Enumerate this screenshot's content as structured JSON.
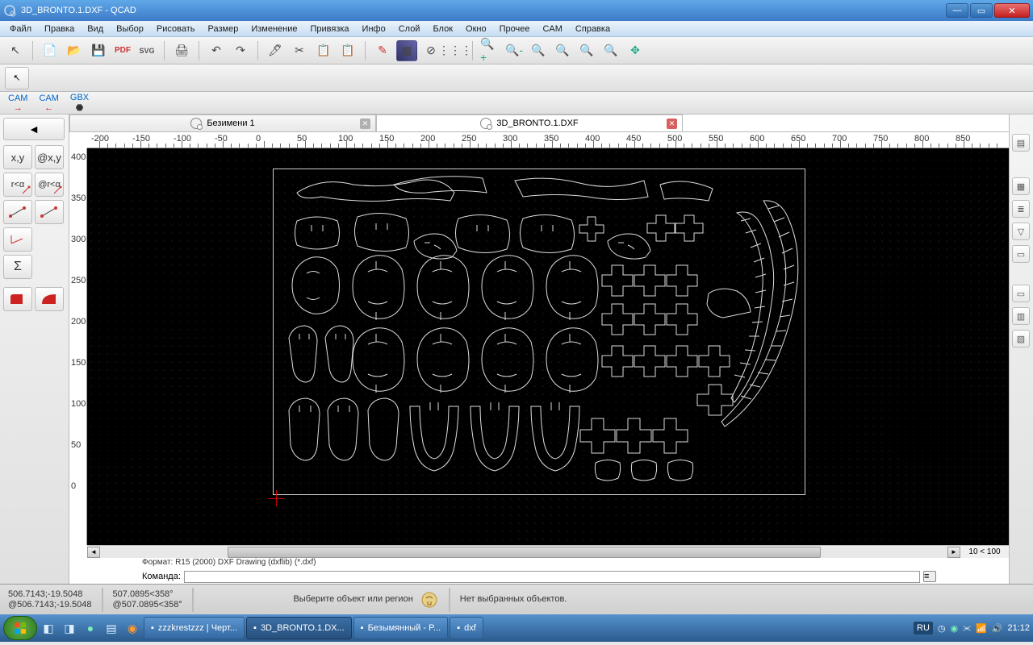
{
  "title": "3D_BRONTO.1.DXF - QCAD",
  "menu": [
    "Файл",
    "Правка",
    "Вид",
    "Выбор",
    "Рисовать",
    "Размер",
    "Изменение",
    "Привязка",
    "Инфо",
    "Слой",
    "Блок",
    "Окно",
    "Прочее",
    "CAM",
    "Справка"
  ],
  "cam_tools": [
    "CAM",
    "CAM",
    "GBX"
  ],
  "left_tools": {
    "back": "◄",
    "row1": [
      "x,y",
      "@x,y"
    ],
    "row2": [
      "r<α",
      "@r<α"
    ],
    "sigma": "Σ"
  },
  "tabs": [
    {
      "label": "Безимени 1",
      "active": false
    },
    {
      "label": "3D_BRONTO.1.DXF",
      "active": true
    }
  ],
  "ruler_h": [
    "-200",
    "-150",
    "-100",
    "-50",
    "0",
    "50",
    "100",
    "150",
    "200",
    "250",
    "300",
    "350",
    "400",
    "450",
    "500",
    "550",
    "600",
    "650",
    "700",
    "750",
    "800",
    "850"
  ],
  "ruler_v": [
    "400",
    "350",
    "300",
    "250",
    "200",
    "150",
    "100",
    "50",
    "0"
  ],
  "zoom_info": "10 < 100",
  "format_line": "Формат: R15 (2000) DXF Drawing (dxflib) (*.dxf)",
  "command_label": "Команда:",
  "status": {
    "abs_coord": "506.7143;-19.5048",
    "rel_coord": "@506.7143;-19.5048",
    "polar": "507.0895<358°",
    "rel_polar": "@507.0895<358°",
    "hint": "Выберите объект или регион",
    "selection": "Нет выбранных объектов."
  },
  "taskbar": {
    "items": [
      {
        "label": "zzzkrestzzz | Черт..."
      },
      {
        "label": "3D_BRONTO.1.DX..."
      },
      {
        "label": "Безымянный - P..."
      },
      {
        "label": "dxf"
      }
    ],
    "lang": "RU",
    "time": "21:12"
  }
}
